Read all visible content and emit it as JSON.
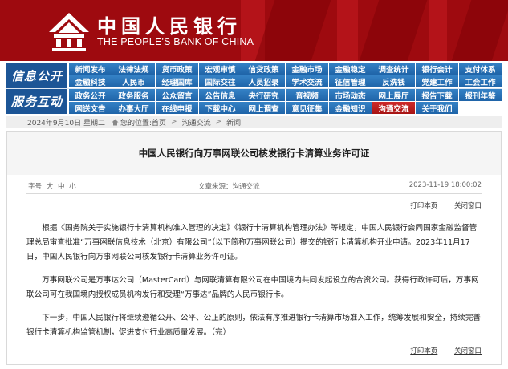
{
  "header": {
    "brand_cn": "中国人民银行",
    "brand_en": "THE PEOPLE'S BANK OF CHINA",
    "logo": "pboc-logo-icon",
    "colors": {
      "banner": "#9e0a0f",
      "nav": "#2a73b8",
      "nav_selected": "#c21e1e",
      "section": "#1c5596"
    }
  },
  "nav": {
    "section_info": "信息公开",
    "section_service": "服务互动",
    "info_row1": [
      "新闻发布",
      "法律法规",
      "货币政策",
      "宏观审慎",
      "信贷政策",
      "金融市场",
      "金融稳定",
      "调查统计",
      "银行会计",
      "支付体系"
    ],
    "info_row2": [
      "金融科技",
      "人民币",
      "经理国库",
      "国际交往",
      "人员招录",
      "学术交流",
      "征信管理",
      "反洗钱",
      "党建工作",
      "工会工作"
    ],
    "service_row1": [
      "政务公开",
      "政务服务",
      "公众留言",
      "公告信息",
      "央行研究",
      "音视频",
      "市场动态",
      "网上展厅",
      "报告下载",
      "报刊年鉴"
    ],
    "service_row2": [
      "网送文告",
      "办事大厅",
      "在线申报",
      "下载中心",
      "网上调查",
      "意见征集",
      "金融知识",
      "关于我们"
    ],
    "selected": "沟通交流"
  },
  "breadcrumb": {
    "date": "2024年9月10日  星期二",
    "prefix": "您的位置:",
    "items": [
      "首页",
      "沟通交流",
      "新闻"
    ]
  },
  "article": {
    "title": "中国人民银行向万事网联公司核发银行卡清算业务许可证",
    "font_size_label": "字号",
    "font_sizes": [
      "大",
      "中",
      "小"
    ],
    "source": "文章来源：沟通交流",
    "date": "2023-11-19  18:00:02",
    "print_label": "打印本页",
    "close_label": "关闭窗口",
    "paragraphs": [
      "根据《国务院关于实施银行卡清算机构准入管理的决定》《银行卡清算机构管理办法》等规定，中国人民银行会同国家金融监督管理总局审查批准“万事网联信息技术（北京）有限公司”（以下简称万事网联公司）提交的银行卡清算机构开业申请。2023年11月17日，中国人民银行向万事网联公司核发银行卡清算业务许可证。",
      "万事网联公司是万事达公司（MasterCard）与网联清算有限公司在中国境内共同发起设立的合资公司。获得行政许可后，万事网联公司可在我国境内授权成员机构发行和受理“万事达”品牌的人民币银行卡。",
      "下一步，中国人民银行将继续遵循公开、公平、公正的原则，依法有序推进银行卡清算市场准入工作，统筹发展和安全，持续完善银行卡清算机构监管机制，促进支付行业高质量发展。（完）"
    ]
  }
}
